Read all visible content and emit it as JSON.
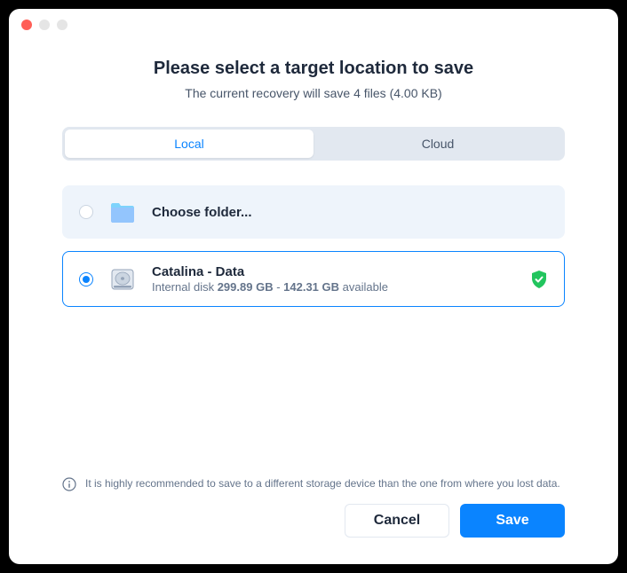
{
  "header": {
    "title": "Please select a target location to save",
    "subtitle": "The current recovery will save 4 files (4.00 KB)"
  },
  "tabs": {
    "local": "Local",
    "cloud": "Cloud"
  },
  "options": {
    "choose_folder": {
      "title": "Choose folder..."
    },
    "disk": {
      "title": "Catalina - Data",
      "sub_prefix": "Internal disk ",
      "total": "299.89 GB",
      "separator": " - ",
      "available_value": "142.31 GB",
      "available_suffix": " available"
    }
  },
  "note": "It is highly recommended to save to a different storage device than the one from where you lost data.",
  "buttons": {
    "cancel": "Cancel",
    "save": "Save"
  }
}
